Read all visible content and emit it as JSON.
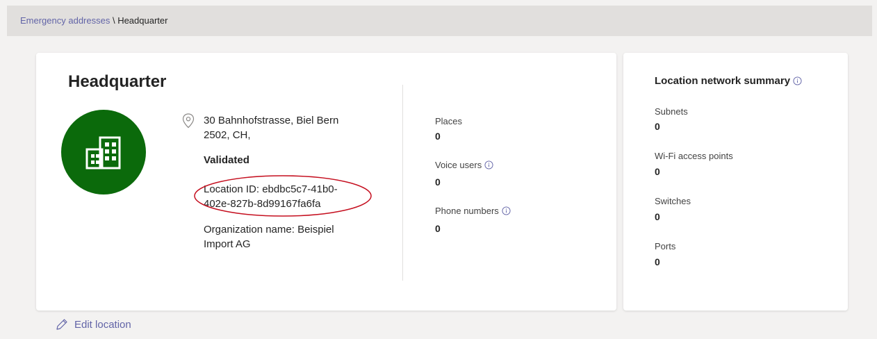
{
  "breadcrumb": {
    "parent": "Emergency addresses",
    "separator": " \\ ",
    "current": "Headquarter"
  },
  "location": {
    "title": "Headquarter",
    "address_line1": "30 Bahnhofstrasse, Biel Bern",
    "address_line2": "2502, CH,",
    "status": "Validated",
    "location_id_line1": "Location ID: ebdbc5c7-41b0-",
    "location_id_line2": "402e-827b-8d99167fa6fa",
    "org_line1": "Organization name: Beispiel",
    "org_line2": "Import AG",
    "avatar_icon": "building-icon",
    "avatar_color": "#0b6a0b"
  },
  "stats": {
    "places_label": "Places",
    "places_value": "0",
    "voice_users_label": "Voice users",
    "voice_users_value": "0",
    "phone_numbers_label": "Phone numbers",
    "phone_numbers_value": "0"
  },
  "network_summary": {
    "title": "Location network summary",
    "subnets_label": "Subnets",
    "subnets_value": "0",
    "wifi_label": "Wi-Fi access points",
    "wifi_value": "0",
    "switches_label": "Switches",
    "switches_value": "0",
    "ports_label": "Ports",
    "ports_value": "0"
  },
  "actions": {
    "edit_label": "Edit location"
  },
  "colors": {
    "accent": "#6264a7",
    "annotation": "#c50f1f"
  }
}
